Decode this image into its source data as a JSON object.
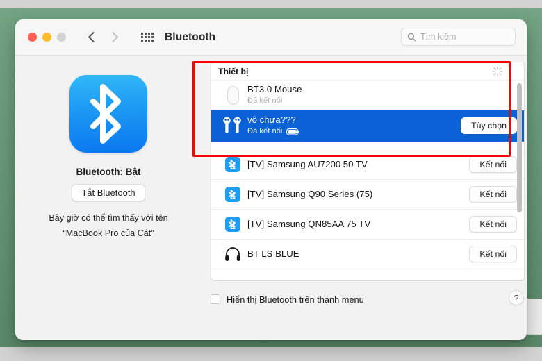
{
  "window": {
    "title": "Bluetooth",
    "traffic_lights": [
      "close",
      "minimize",
      "zoom"
    ],
    "back_icon": "chevron-left-icon",
    "forward_icon": "chevron-right-icon",
    "grid_icon": "grid-apps-icon"
  },
  "search": {
    "icon": "search-icon",
    "placeholder": "Tìm kiếm",
    "value": ""
  },
  "left_panel": {
    "app_icon": "bluetooth-icon",
    "status": "Bluetooth: Bật",
    "toggle_label": "Tắt Bluetooth",
    "discoverable_line1": "Bây giờ có thể tìm thấy với tên",
    "discoverable_line2": "“MacBook Pro của Cát”"
  },
  "device_list": {
    "header": "Thiết bị",
    "spinner_icon": "loading-spinner-icon",
    "connected": [
      {
        "name": "BT3.0 Mouse",
        "status": "Đã kết nối",
        "icon": "mouse-icon",
        "selected": false,
        "battery": false,
        "action": ""
      },
      {
        "name": "vô chưa???",
        "status": "Đã kết nối",
        "icon": "airpods-icon",
        "selected": true,
        "battery": true,
        "action": "Tùy chọn"
      }
    ],
    "available": [
      {
        "name": "[TV] Samsung AU7200 50 TV",
        "icon": "bluetooth-badge-icon",
        "action": "Kết nối"
      },
      {
        "name": "[TV] Samsung Q90 Series (75)",
        "icon": "bluetooth-badge-icon",
        "action": "Kết nối"
      },
      {
        "name": "[TV] Samsung QN85AA 75 TV",
        "icon": "bluetooth-badge-icon",
        "action": "Kết nối"
      },
      {
        "name": "BT LS BLUE",
        "icon": "headphones-icon",
        "action": "Kết nối"
      }
    ]
  },
  "footer": {
    "checkbox_label": "Hiển thị Bluetooth trên thanh menu",
    "checked": false,
    "help_label": "?"
  },
  "colors": {
    "selection_blue": "#0b62d6",
    "annotation_red": "#ff0000",
    "desktop_green": "#649a75",
    "bluetooth_blue": "#1e9df4"
  }
}
